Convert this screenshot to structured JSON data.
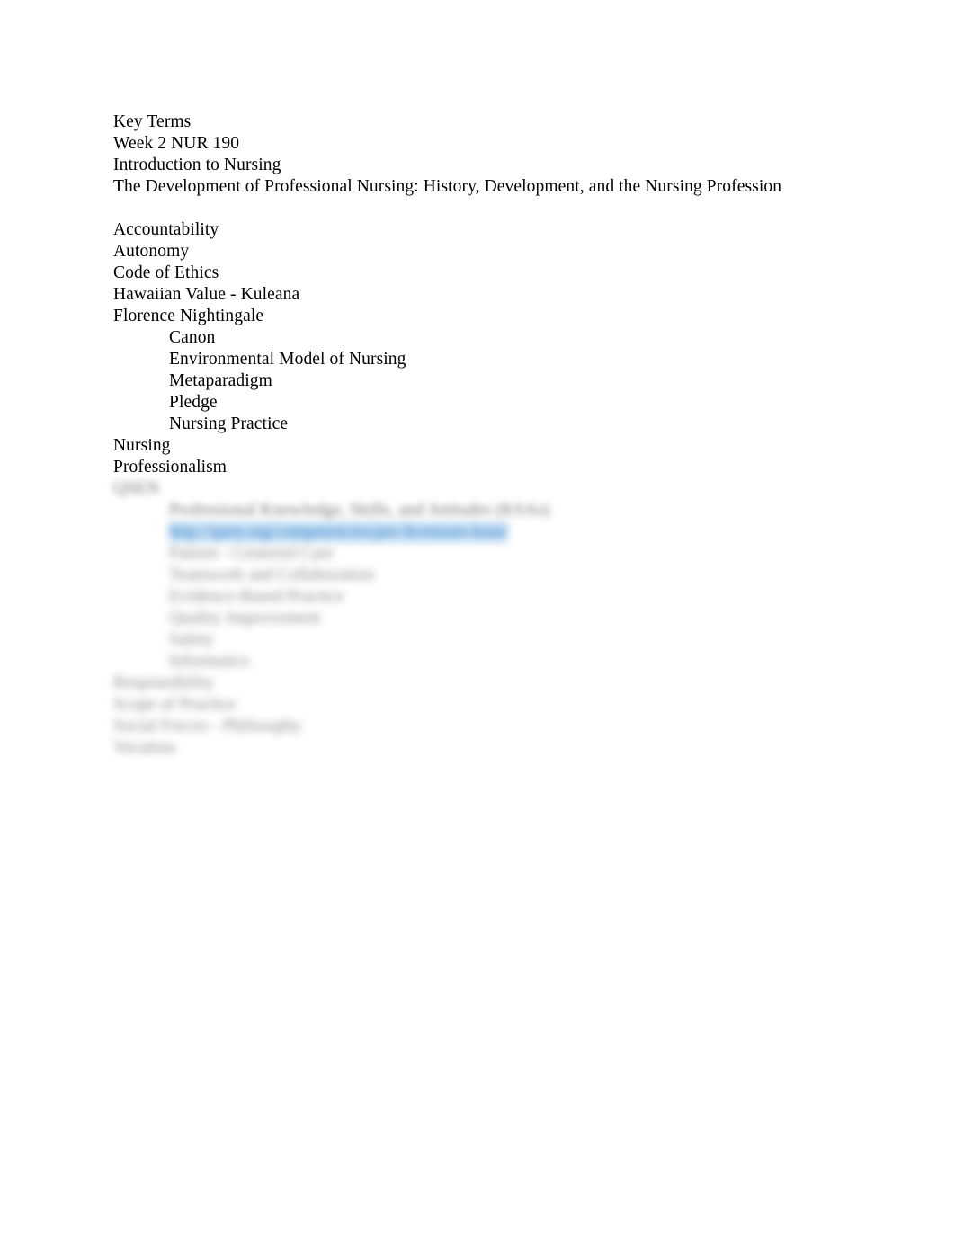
{
  "document": {
    "heading_lines": [
      "Key Terms",
      "Week 2 NUR 190",
      "Introduction to Nursing",
      "The Development of Professional Nursing: History, Development, and the Nursing Profession"
    ],
    "terms": [
      "Accountability",
      "Autonomy",
      "Code of Ethics",
      "Hawaiian Value - Kuleana",
      "Florence Nightingale"
    ],
    "nightingale_subterms": [
      "Canon",
      "Environmental Model of Nursing",
      "Metaparadigm",
      "Pledge",
      "Nursing Practice"
    ],
    "terms_continued": [
      "Nursing",
      "Professionalism"
    ],
    "redacted": {
      "note": "blurred",
      "left_margin_line": "QSEN",
      "indented_lines": [
        "Professional Knowledge, Skills, and Attitudes (KSAs)",
        "http://qsen.org/competencies/pre-licensure-ksas/",
        "Patient - Centered Care",
        "Teamwork and Collaboration",
        "Evidence-Based Practice",
        "Quality Improvement",
        "Safety",
        "Informatics"
      ],
      "closing_lines": [
        "Responsibility",
        "Scope of Practice",
        "Social Forces - Philosophy",
        "Vocation"
      ],
      "link_color": "#1155cc",
      "link_highlight_color": "#96c3e8"
    }
  }
}
